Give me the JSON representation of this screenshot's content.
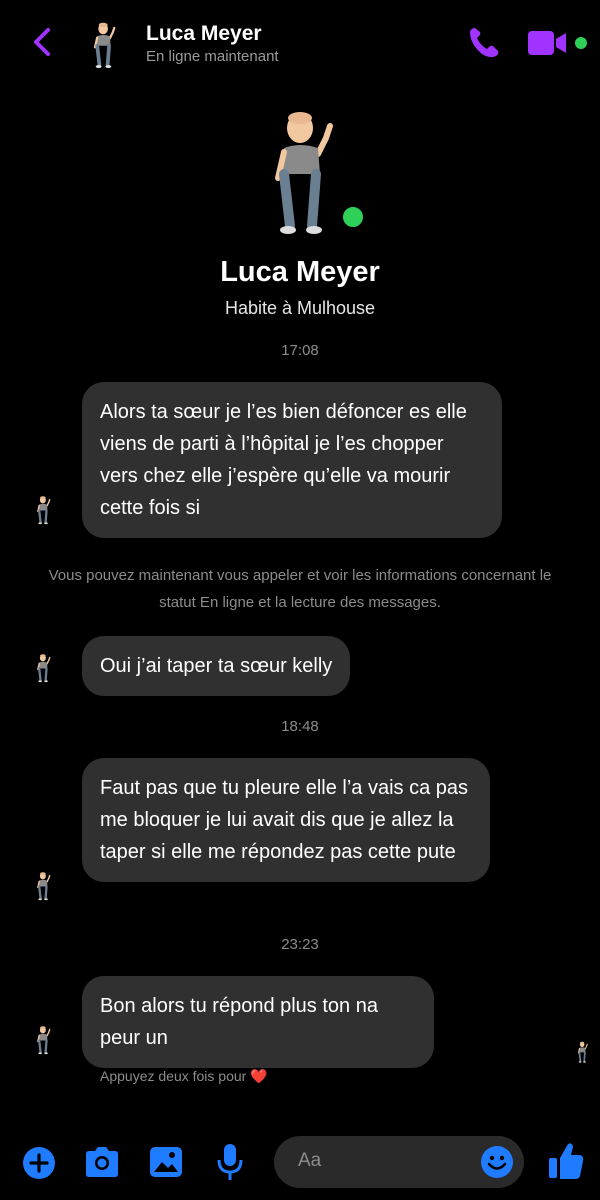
{
  "header": {
    "contact_name": "Luca Meyer",
    "status": "En ligne maintenant"
  },
  "profile": {
    "name": "Luca Meyer",
    "subtitle": "Habite à Mulhouse"
  },
  "conversation": {
    "timestamps": [
      "17:08",
      "18:48",
      "23:23"
    ],
    "messages": [
      {
        "text": "Alors ta sœur je l’es bien défoncer es elle viens de parti à l’hôpital je l’es chopper vers chez elle j’espère qu’elle va mourir cette fois si"
      },
      {
        "text": "Oui j’ai taper ta sœur kelly"
      },
      {
        "text": "Faut pas que tu pleure elle l’a vais ca pas me bloquer je lui avait dis que je allez la taper si elle me répondez pas cette pute"
      },
      {
        "text": "Bon alors tu répond plus ton na peur un"
      }
    ],
    "info_note": "Vous pouvez maintenant vous appeler et voir les informations concernant le statut En ligne et la lecture des messages.",
    "double_tap_hint": "Appuyez deux fois pour",
    "hint_emoji": "❤️"
  },
  "composer": {
    "placeholder": "Aa"
  },
  "colors": {
    "accent": "#a033ff",
    "messenger_blue": "#1f7bff",
    "online_green": "#2fd058",
    "bubble_bg": "#303030"
  },
  "icons": [
    "back-arrow-icon",
    "phone-icon",
    "video-camera-icon",
    "plus-icon",
    "camera-icon",
    "gallery-icon",
    "microphone-icon",
    "emoji-icon",
    "thumbs-up-icon"
  ]
}
